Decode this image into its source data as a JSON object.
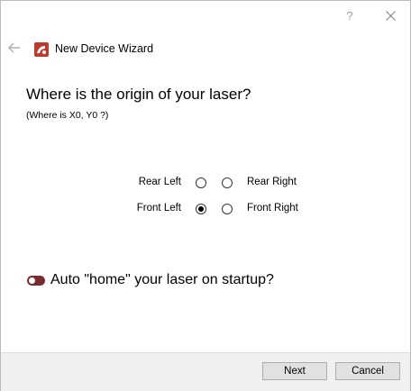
{
  "window": {
    "help_label": "?",
    "close_icon": "close-icon",
    "back_icon": "back-arrow-icon",
    "logo_icon": "app-logo-icon"
  },
  "header": {
    "title": "New Device Wizard"
  },
  "content": {
    "question": "Where is the origin of your laser?",
    "subtitle": "(Where is X0, Y0 ?)"
  },
  "origin": {
    "options": [
      {
        "label": "Rear Left",
        "checked": false
      },
      {
        "label": "Rear Right",
        "checked": false
      },
      {
        "label": "Front Left",
        "checked": true
      },
      {
        "label": "Front Right",
        "checked": false
      }
    ]
  },
  "auto_home": {
    "label": "Auto \"home\" your laser on startup?",
    "enabled": true
  },
  "footer": {
    "next_label": "Next",
    "cancel_label": "Cancel"
  },
  "colors": {
    "accent": "#7a2c30",
    "logo_red": "#c0392b"
  }
}
